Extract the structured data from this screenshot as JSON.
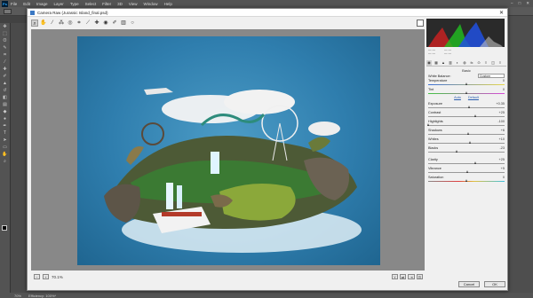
{
  "menubar": {
    "logo": "Ps",
    "items": [
      "File",
      "Edit",
      "Image",
      "Layer",
      "Type",
      "Select",
      "Filter",
      "3D",
      "View",
      "Window",
      "Help"
    ]
  },
  "dialog": {
    "title": "Camera Raw (Jurassic Island_final.psd)",
    "close": "✕"
  },
  "preview": {
    "zoom": "70.1%"
  },
  "panel": {
    "section": "Basic",
    "white_balance_label": "White Balance:",
    "white_balance_value": "Custom",
    "auto_link": "Auto",
    "default_link": "Default",
    "sliders": [
      {
        "label": "Temperature",
        "value": "0",
        "pos": 0.5,
        "kind": "temp"
      },
      {
        "label": "Tint",
        "value": "0",
        "pos": 0.5,
        "kind": "tint"
      },
      {
        "label": "Exposure",
        "value": "+0.35",
        "pos": 0.54,
        "kind": "plain"
      },
      {
        "label": "Contrast",
        "value": "+25",
        "pos": 0.62,
        "kind": "plain"
      },
      {
        "label": "Highlights",
        "value": "-100",
        "pos": 0.0,
        "kind": "plain"
      },
      {
        "label": "Shadows",
        "value": "+6",
        "pos": 0.53,
        "kind": "plain"
      },
      {
        "label": "Whites",
        "value": "+10",
        "pos": 0.55,
        "kind": "plain"
      },
      {
        "label": "Blacks",
        "value": "-23",
        "pos": 0.38,
        "kind": "plain"
      },
      {
        "label": "Clarity",
        "value": "+25",
        "pos": 0.62,
        "kind": "plain"
      },
      {
        "label": "Vibrance",
        "value": "+5",
        "pos": 0.52,
        "kind": "plain"
      },
      {
        "label": "Saturation",
        "value": "0",
        "pos": 0.5,
        "kind": "sat"
      }
    ]
  },
  "footer": {
    "cancel": "Cancel",
    "ok": "OK"
  },
  "status": {
    "zoom": "70%",
    "efficiency": "Efficiency: 100%*"
  }
}
